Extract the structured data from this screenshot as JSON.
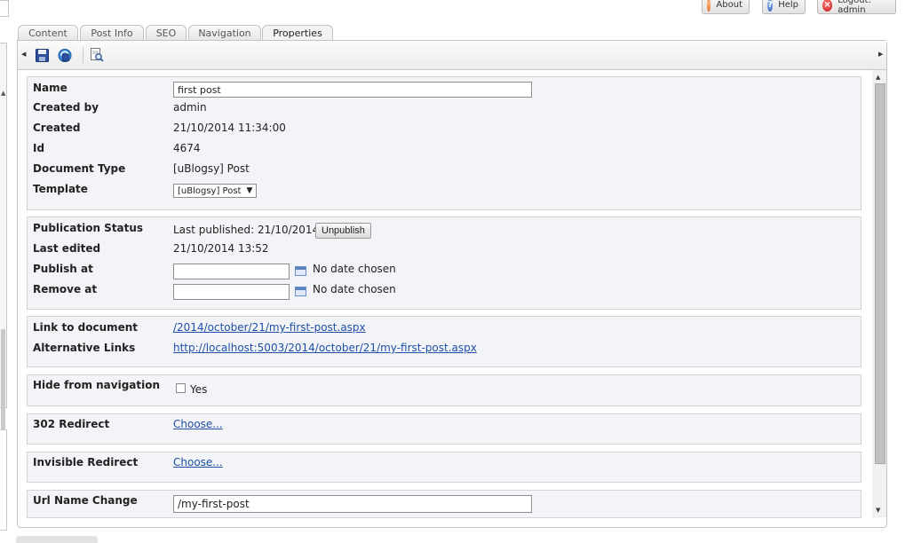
{
  "header": {
    "about_label": "About",
    "help_label": "Help",
    "logout_label": "Logout: admin"
  },
  "tabs": [
    {
      "label": "Content"
    },
    {
      "label": "Post Info"
    },
    {
      "label": "SEO"
    },
    {
      "label": "Navigation"
    },
    {
      "label": "Properties"
    }
  ],
  "active_tab": "Properties",
  "toolbar": {
    "icons": [
      "save-icon",
      "save-and-publish-icon",
      "preview-icon"
    ]
  },
  "info": {
    "name_label": "Name",
    "name_value": "first post",
    "created_by_label": "Created by",
    "created_by_value": "admin",
    "created_label": "Created",
    "created_value": "21/10/2014 11:34:00",
    "id_label": "Id",
    "id_value": "4674",
    "doc_type_label": "Document Type",
    "doc_type_value": "[uBlogsy] Post",
    "template_label": "Template",
    "template_value": "[uBlogsy] Post"
  },
  "publication": {
    "status_label": "Publication Status",
    "status_value": "Last published: 21/10/2014",
    "unpublish_label": "Unpublish",
    "last_edited_label": "Last edited",
    "last_edited_value": "21/10/2014 13:52",
    "publish_at_label": "Publish at",
    "publish_at_value": "",
    "publish_at_note": "No date chosen",
    "remove_at_label": "Remove at",
    "remove_at_value": "",
    "remove_at_note": "No date chosen"
  },
  "links": {
    "link_label": "Link to document",
    "link_value": "/2014/october/21/my-first-post.aspx",
    "alt_label": "Alternative Links",
    "alt_value": "http://localhost:5003/2014/october/21/my-first-post.aspx"
  },
  "navigation": {
    "hide_label": "Hide from navigation",
    "hide_option": "Yes",
    "hide_checked": false
  },
  "redirect302": {
    "label": "302 Redirect",
    "choose_label": "Choose..."
  },
  "invisible_redirect": {
    "label": "Invisible Redirect",
    "choose_label": "Choose..."
  },
  "url_name": {
    "label": "Url Name Change",
    "value": "/my-first-post"
  },
  "colors": {
    "link": "#1f4fa8",
    "panel_bg": "#f3f4f7"
  }
}
